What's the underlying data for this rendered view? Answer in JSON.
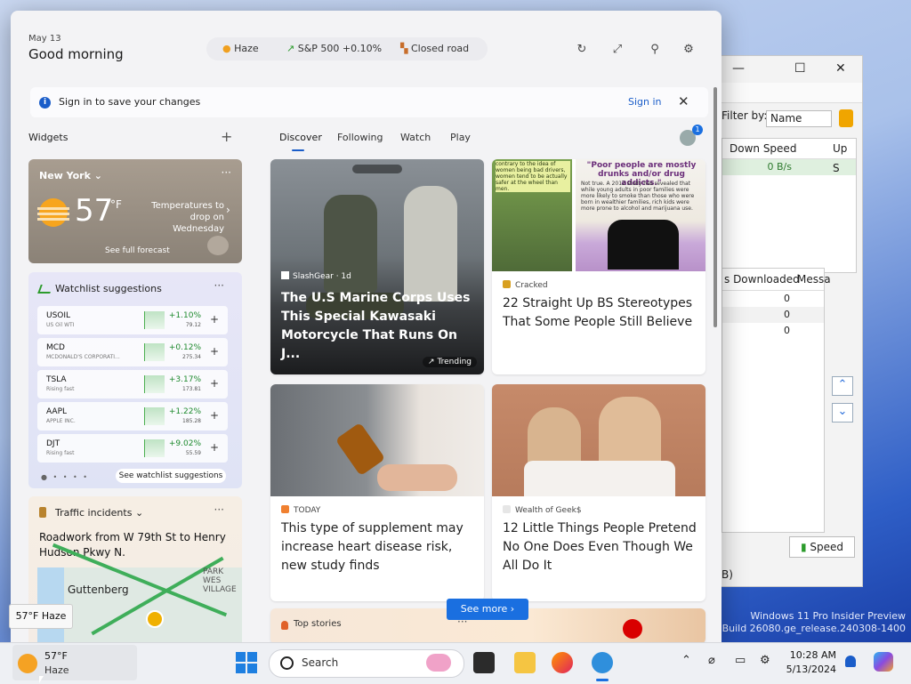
{
  "header": {
    "date": "May 13",
    "greeting": "Good morning",
    "chips": [
      {
        "label": "Haze",
        "icon": "haze-icon"
      },
      {
        "label": "S&P 500 +0.10%",
        "icon": "stock-up-icon"
      },
      {
        "label": "Closed road",
        "icon": "closed-road-icon"
      }
    ],
    "icons": [
      "refresh-icon",
      "expand-icon",
      "pin-icon",
      "gear-icon"
    ]
  },
  "signin_bar": {
    "message": "Sign in to save your changes",
    "link": "Sign in",
    "close": "✕"
  },
  "widgets": {
    "label": "Widgets",
    "add": "+",
    "weather": {
      "city": "New York",
      "temp": "57",
      "unit": "°F",
      "note": "Temperatures to drop on Wednesday",
      "forecast_link": "See full forecast",
      "menu": "···"
    },
    "watchlist": {
      "title": "Watchlist suggestions",
      "menu": "···",
      "stocks": [
        {
          "symbol": "USOIL",
          "name": "US Oil WTI",
          "change": "+1.10%",
          "price": "79.12"
        },
        {
          "symbol": "MCD",
          "name": "MCDONALD'S CORPORATI...",
          "change": "+0.12%",
          "price": "275.34"
        },
        {
          "symbol": "TSLA",
          "name": "Rising fast",
          "change": "+3.17%",
          "price": "173.81"
        },
        {
          "symbol": "AAPL",
          "name": "APPLE INC.",
          "change": "+1.22%",
          "price": "185.28"
        },
        {
          "symbol": "DJT",
          "name": "Rising fast",
          "change": "+9.02%",
          "price": "55.59"
        }
      ],
      "add": "+",
      "see_more": "See watchlist suggestions",
      "pager": "● • • • •"
    },
    "traffic": {
      "title": "Traffic incidents",
      "menu": "···",
      "description": "Roadwork from W 79th St to Henry Hudson Pkwy N.",
      "map_city": "Guttenberg",
      "map_label": "PARK WES VILLAGE"
    }
  },
  "tooltip": "57°F Haze",
  "feed": {
    "tabs": [
      "Discover",
      "Following",
      "Watch",
      "Play"
    ],
    "profile_badge": "1",
    "hero": {
      "source": "SlashGear · 1d",
      "title": "The U.S Marine Corps Uses This Special Kawasaki Motorcycle That Runs On J...",
      "trending": "Trending"
    },
    "card2": {
      "image_left_text": "contrary to the idea of women being bad drivers, women tend to be actually safer at the wheel than men.",
      "image_right_heading": "\"Poor people are mostly drunks and/or drug addicts.\"",
      "image_right_text": "Not true. A 2012 study has revealed that while young adults in poor families were more likely to smoke than those who were born in wealthier families, rich kids were more prone to alcohol and marijuana use.",
      "source": "Cracked",
      "title": "22 Straight Up BS Stereotypes That Some People Still Believe"
    },
    "card3": {
      "source": "TODAY",
      "title": "This type of supplement may increase heart disease risk, new study finds"
    },
    "card4": {
      "source": "Wealth of Geek$",
      "title": "12 Little Things People Pretend No One Does Even Though We All Do It"
    },
    "card5": {
      "source": "Top stories",
      "menu": "···"
    },
    "see_more": "See more"
  },
  "qbittorrent": {
    "filter_label": "Filter by:",
    "filter_value": "Name",
    "columns": [
      "Down Speed",
      "Up S"
    ],
    "speed_value": "0 B/s",
    "columns2": [
      "s Downloaded",
      "Messa"
    ],
    "zeros": [
      "0",
      "0",
      "0"
    ],
    "speed_button": "Speed",
    "bottom_text": "B)"
  },
  "watermark": {
    "line1": "Windows 11 Pro Insider Preview",
    "line2": "Evaluation copy. Build 26080.ge_release.240308-1400"
  },
  "taskbar": {
    "weather_temp": "57°F",
    "weather_cond": "Haze",
    "search_label": "Search",
    "time": "10:28 AM",
    "date": "5/13/2024"
  },
  "colors": {
    "accent": "#1a6fe0",
    "positive": "#1e8a2e"
  }
}
